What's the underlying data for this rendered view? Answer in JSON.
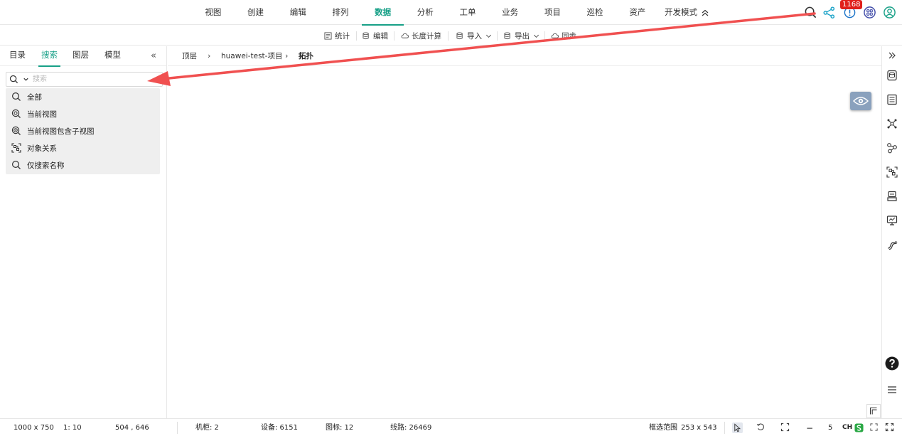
{
  "top_menu": {
    "items": [
      "视图",
      "创建",
      "编辑",
      "排列",
      "数据",
      "分析",
      "工单",
      "业务",
      "项目",
      "巡检",
      "资产"
    ],
    "active_index": 4,
    "dev_mode_label": "开发模式"
  },
  "notifications": {
    "count": "1168"
  },
  "toolbar": {
    "stats": "统计",
    "edit": "编辑",
    "length_calc": "长度计算",
    "import": "导入",
    "export": "导出",
    "sync": "同步"
  },
  "left_tabs": [
    "目录",
    "搜索",
    "图层",
    "模型"
  ],
  "left_active_tab": 1,
  "search": {
    "placeholder": "搜索",
    "options": [
      "全部",
      "当前视图",
      "当前视图包含子视图",
      "对象关系",
      "仅搜索名称"
    ]
  },
  "breadcrumb": [
    "顶层",
    "huawei-test-项目",
    "拓扑"
  ],
  "statusbar": {
    "canvas_size": "1000 x 750",
    "scale": "1: 10",
    "cursor_pos": "504 , 646",
    "cabinet": "机柜: 2",
    "device": "设备: 6151",
    "icon_label": "图标: 12",
    "line": "线路: 26469",
    "select_range_label": "框选范围",
    "select_range_value": "253 x 543",
    "zoom_minus": "−",
    "zoom_value": "5",
    "ime": "CH"
  },
  "colors": {
    "accent": "#17a087",
    "badge": "#e0201b",
    "arrow": "#f05050",
    "eye_button": "#8aa1bd",
    "dropdown_bg": "#efefef"
  },
  "icons": {
    "top_right": [
      "search-icon",
      "share-icon",
      "notification-icon",
      "app-grid-icon",
      "user-icon"
    ],
    "right_rail": [
      "expand-right-icon",
      "database-icon",
      "list-icon",
      "topology-icon",
      "route-icon",
      "relation-icon",
      "device-icon",
      "monitor-icon",
      "cable-icon",
      "help-icon",
      "menu-icon"
    ]
  }
}
